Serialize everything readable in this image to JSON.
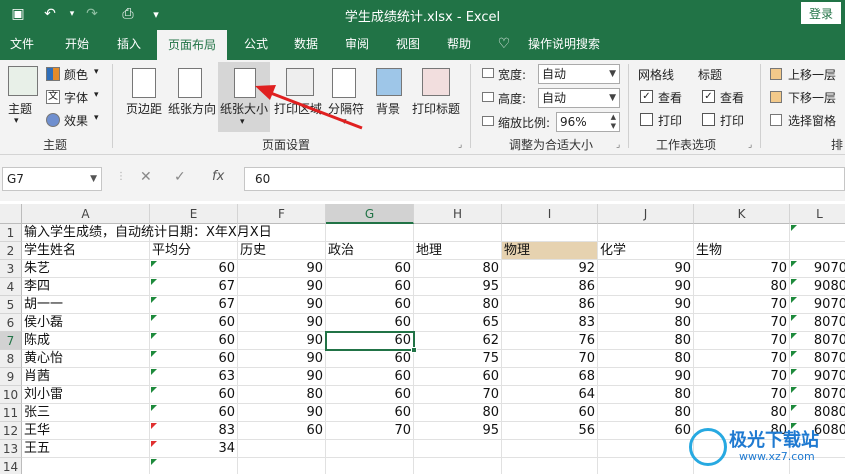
{
  "titlebar": {
    "title": "学生成绩统计.xlsx  -  Excel",
    "login": "登录",
    "icons": [
      "save-icon",
      "undo-icon",
      "redo-icon",
      "print-preview-icon",
      "customize-icon"
    ]
  },
  "tabs": [
    "文件",
    "开始",
    "插入",
    "页面布局",
    "公式",
    "数据",
    "审阅",
    "视图",
    "帮助",
    "操作说明搜索"
  ],
  "active_tab": "页面布局",
  "ribbon": {
    "theme": {
      "main": "主题",
      "colors": "颜色",
      "fonts": "字体",
      "effects": "效果",
      "group": "主题"
    },
    "page_setup": {
      "margins": "页边距",
      "orientation": "纸张方向",
      "size": "纸张大小",
      "print_area": "打印区域",
      "breaks": "分隔符",
      "background": "背景",
      "print_titles": "打印标题",
      "group": "页面设置"
    },
    "scale": {
      "width_label": "宽度:",
      "width_value": "自动",
      "height_label": "高度:",
      "height_value": "自动",
      "scale_label": "缩放比例:",
      "scale_value": "96%",
      "group": "调整为合适大小"
    },
    "sheet_options": {
      "gridlines": "网格线",
      "headings": "标题",
      "view1": "查看",
      "print1": "打印",
      "view2": "查看",
      "print2": "打印",
      "group": "工作表选项"
    },
    "arrange": {
      "bring_forward": "上移一层",
      "send_backward": "下移一层",
      "selection_pane": "选择窗格",
      "group": "排"
    }
  },
  "formula_bar": {
    "name_box": "G7",
    "fx": "fx",
    "value": "60"
  },
  "columns": [
    "A",
    "E",
    "F",
    "G",
    "H",
    "I",
    "J",
    "K",
    "L"
  ],
  "selected_column": "G",
  "selected_row": "7",
  "rows": [
    {
      "n": "1",
      "cells": [
        "输入学生成绩，自动统计日期：X年X月X日",
        "",
        "",
        "",
        "",
        "",
        "",
        "",
        ""
      ]
    },
    {
      "n": "2",
      "cells": [
        "学生姓名",
        "平均分",
        "历史",
        "政治",
        "地理",
        "物理",
        "化学",
        "生物",
        ""
      ]
    },
    {
      "n": "3",
      "cells": [
        "朱艺",
        "60",
        "90",
        "60",
        "80",
        "92",
        "90",
        "70",
        "9070"
      ]
    },
    {
      "n": "4",
      "cells": [
        "李四",
        "67",
        "90",
        "60",
        "95",
        "86",
        "90",
        "80",
        "9080"
      ]
    },
    {
      "n": "5",
      "cells": [
        "胡一一",
        "67",
        "90",
        "60",
        "80",
        "86",
        "90",
        "70",
        "9070"
      ]
    },
    {
      "n": "6",
      "cells": [
        "侯小磊",
        "60",
        "90",
        "60",
        "65",
        "83",
        "80",
        "70",
        "8070"
      ]
    },
    {
      "n": "7",
      "cells": [
        "陈成",
        "60",
        "90",
        "60",
        "62",
        "76",
        "80",
        "70",
        "8070"
      ]
    },
    {
      "n": "8",
      "cells": [
        "黄心怡",
        "60",
        "90",
        "60",
        "75",
        "70",
        "80",
        "70",
        "8070"
      ]
    },
    {
      "n": "9",
      "cells": [
        "肖茜",
        "63",
        "90",
        "60",
        "60",
        "68",
        "90",
        "70",
        "9070"
      ]
    },
    {
      "n": "10",
      "cells": [
        "刘小雷",
        "60",
        "80",
        "60",
        "70",
        "64",
        "80",
        "70",
        "8070"
      ]
    },
    {
      "n": "11",
      "cells": [
        "张三",
        "60",
        "90",
        "60",
        "80",
        "60",
        "80",
        "80",
        "8080"
      ]
    },
    {
      "n": "12",
      "cells": [
        "王华",
        "83",
        "60",
        "70",
        "95",
        "56",
        "60",
        "80",
        "6080"
      ]
    },
    {
      "n": "13",
      "cells": [
        "王五",
        "34",
        "",
        "",
        "",
        "",
        "",
        "",
        ""
      ]
    },
    {
      "n": "14",
      "cells": [
        "",
        "",
        "",
        "",
        "",
        "",
        "",
        "",
        ""
      ]
    }
  ],
  "watermark": {
    "name": "极光下载站",
    "url": "www.xz7.com"
  }
}
